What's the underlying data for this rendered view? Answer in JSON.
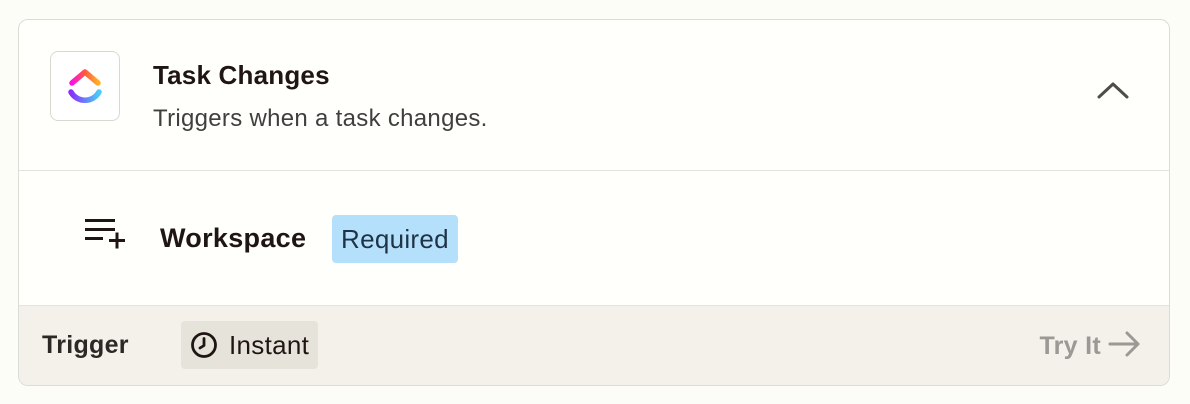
{
  "step": {
    "title": "Task Changes",
    "description": "Triggers when a task changes.",
    "app_icon": "clickup-logo",
    "toggle_icon": "chevron-up-icon"
  },
  "field": {
    "icon": "list-add-icon",
    "label": "Workspace",
    "badge": "Required"
  },
  "footer": {
    "type_label": "Trigger",
    "instant_icon": "clock-icon",
    "instant_label": "Instant",
    "try_label": "Try It",
    "try_icon": "arrow-right-icon"
  },
  "colors": {
    "required_badge_bg": "#b5e0fb",
    "footer_bg": "#f3f1ea",
    "instant_badge_bg": "#e6e4da"
  }
}
